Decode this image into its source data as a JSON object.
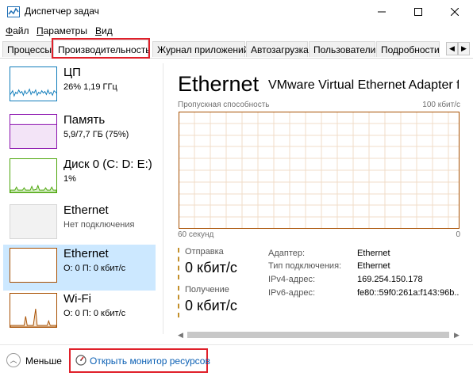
{
  "window": {
    "title": "Диспетчер задач",
    "min_icon": "minimize-icon",
    "max_icon": "maximize-icon",
    "close_icon": "close-icon"
  },
  "menu": {
    "file": {
      "underline": "Ф",
      "rest": "айл"
    },
    "params": {
      "underline": "П",
      "rest": "араметры"
    },
    "view": {
      "underline": "В",
      "rest": "ид"
    }
  },
  "tabs": [
    {
      "label": "Процессы"
    },
    {
      "label": "Производительность",
      "active": true
    },
    {
      "label": "Журнал приложений"
    },
    {
      "label": "Автозагрузка"
    },
    {
      "label": "Пользователи"
    },
    {
      "label": "Подробности"
    }
  ],
  "sidebar": {
    "items": [
      {
        "title": "ЦП",
        "sub": "26%  1,19 ГГц",
        "color": "#117dbb"
      },
      {
        "title": "Память",
        "sub": "5,9/7,7 ГБ (75%)",
        "color": "#8b12ae"
      },
      {
        "title": "Диск 0 (C: D: E:)",
        "sub": "1%",
        "color": "#4da60c"
      },
      {
        "title": "Ethernet",
        "sub": "Нет подключения",
        "color": "#a7a7a7"
      },
      {
        "title": "Ethernet",
        "sub": "О: 0 П: 0 кбит/с",
        "color": "#a74f01",
        "selected": true
      },
      {
        "title": "Wi-Fi",
        "sub": "О: 0 П: 0 кбит/с",
        "color": "#a74f01"
      }
    ]
  },
  "main": {
    "title": "Ethernet",
    "adapter_name": "VMware Virtual Ethernet Adapter fo...",
    "throughput_label": "Пропускная способность",
    "throughput_max": "100 кбит/с",
    "axis_left": "60 секунд",
    "axis_right": "0",
    "graph_color": "#a74f01",
    "send": {
      "label": "Отправка",
      "value": "0 кбит/с"
    },
    "recv": {
      "label": "Получение",
      "value": "0 кбит/с"
    },
    "info": [
      {
        "key": "Адаптер:",
        "value": "Ethernet"
      },
      {
        "key": "Тип подключения:",
        "value": "Ethernet"
      },
      {
        "key": "IPv4-адрес:",
        "value": "169.254.150.178"
      },
      {
        "key": "IPv6-адрес:",
        "value": "fe80::59f0:261a:f143:96b..."
      }
    ]
  },
  "footer": {
    "fewer_label": "Меньше",
    "monitor_link": "Открыть монитор ресурсов"
  }
}
